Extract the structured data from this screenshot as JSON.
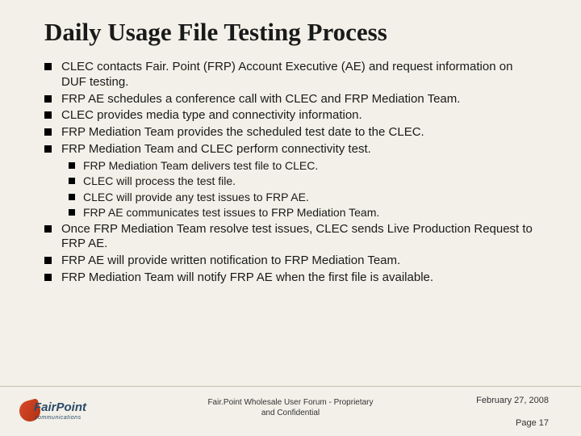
{
  "title": "Daily Usage File Testing Process",
  "bullets": {
    "b1": "CLEC contacts Fair. Point (FRP) Account Executive (AE) and request information on DUF testing.",
    "b2": "FRP AE schedules a conference call with CLEC and FRP Mediation Team.",
    "b3": "CLEC provides media type and connectivity information.",
    "b4": "FRP Mediation Team provides the scheduled test date to the CLEC.",
    "b5": "FRP Mediation Team and CLEC perform connectivity test.",
    "s1": "FRP Mediation Team delivers test file to CLEC.",
    "s2": "CLEC will process the test file.",
    "s3": "CLEC will provide any test issues to FRP AE.",
    "s4": "FRP AE communicates test issues to FRP Mediation Team.",
    "b6": "Once FRP Mediation Team resolve test issues, CLEC sends Live Production Request to FRP AE.",
    "b7": "FRP AE will provide written notification to FRP Mediation Team.",
    "b8": "FRP Mediation Team will notify FRP AE when the first file is available."
  },
  "footer": {
    "center_line1": "Fair.Point Wholesale User Forum - Proprietary",
    "center_line2": "and Confidential",
    "date": "February 27, 2008",
    "page": "Page 17"
  },
  "logo": {
    "main": "FairPoint",
    "sub": "communications"
  }
}
